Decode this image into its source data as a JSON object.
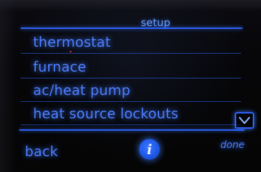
{
  "screen": {
    "title": "setup"
  },
  "menu": {
    "items": [
      {
        "label": "thermostat"
      },
      {
        "label": "furnace"
      },
      {
        "label": "ac/heat pump"
      },
      {
        "label": "heat source lockouts"
      }
    ]
  },
  "footer": {
    "back_label": "back",
    "info_label": "i",
    "done_label": "done"
  },
  "icons": {
    "scroll": "chevron-down-icon",
    "info": "info-icon"
  },
  "colors": {
    "text_blue": "#4f7dff",
    "rule_blue": "#2e63ff",
    "background": "#000000"
  }
}
